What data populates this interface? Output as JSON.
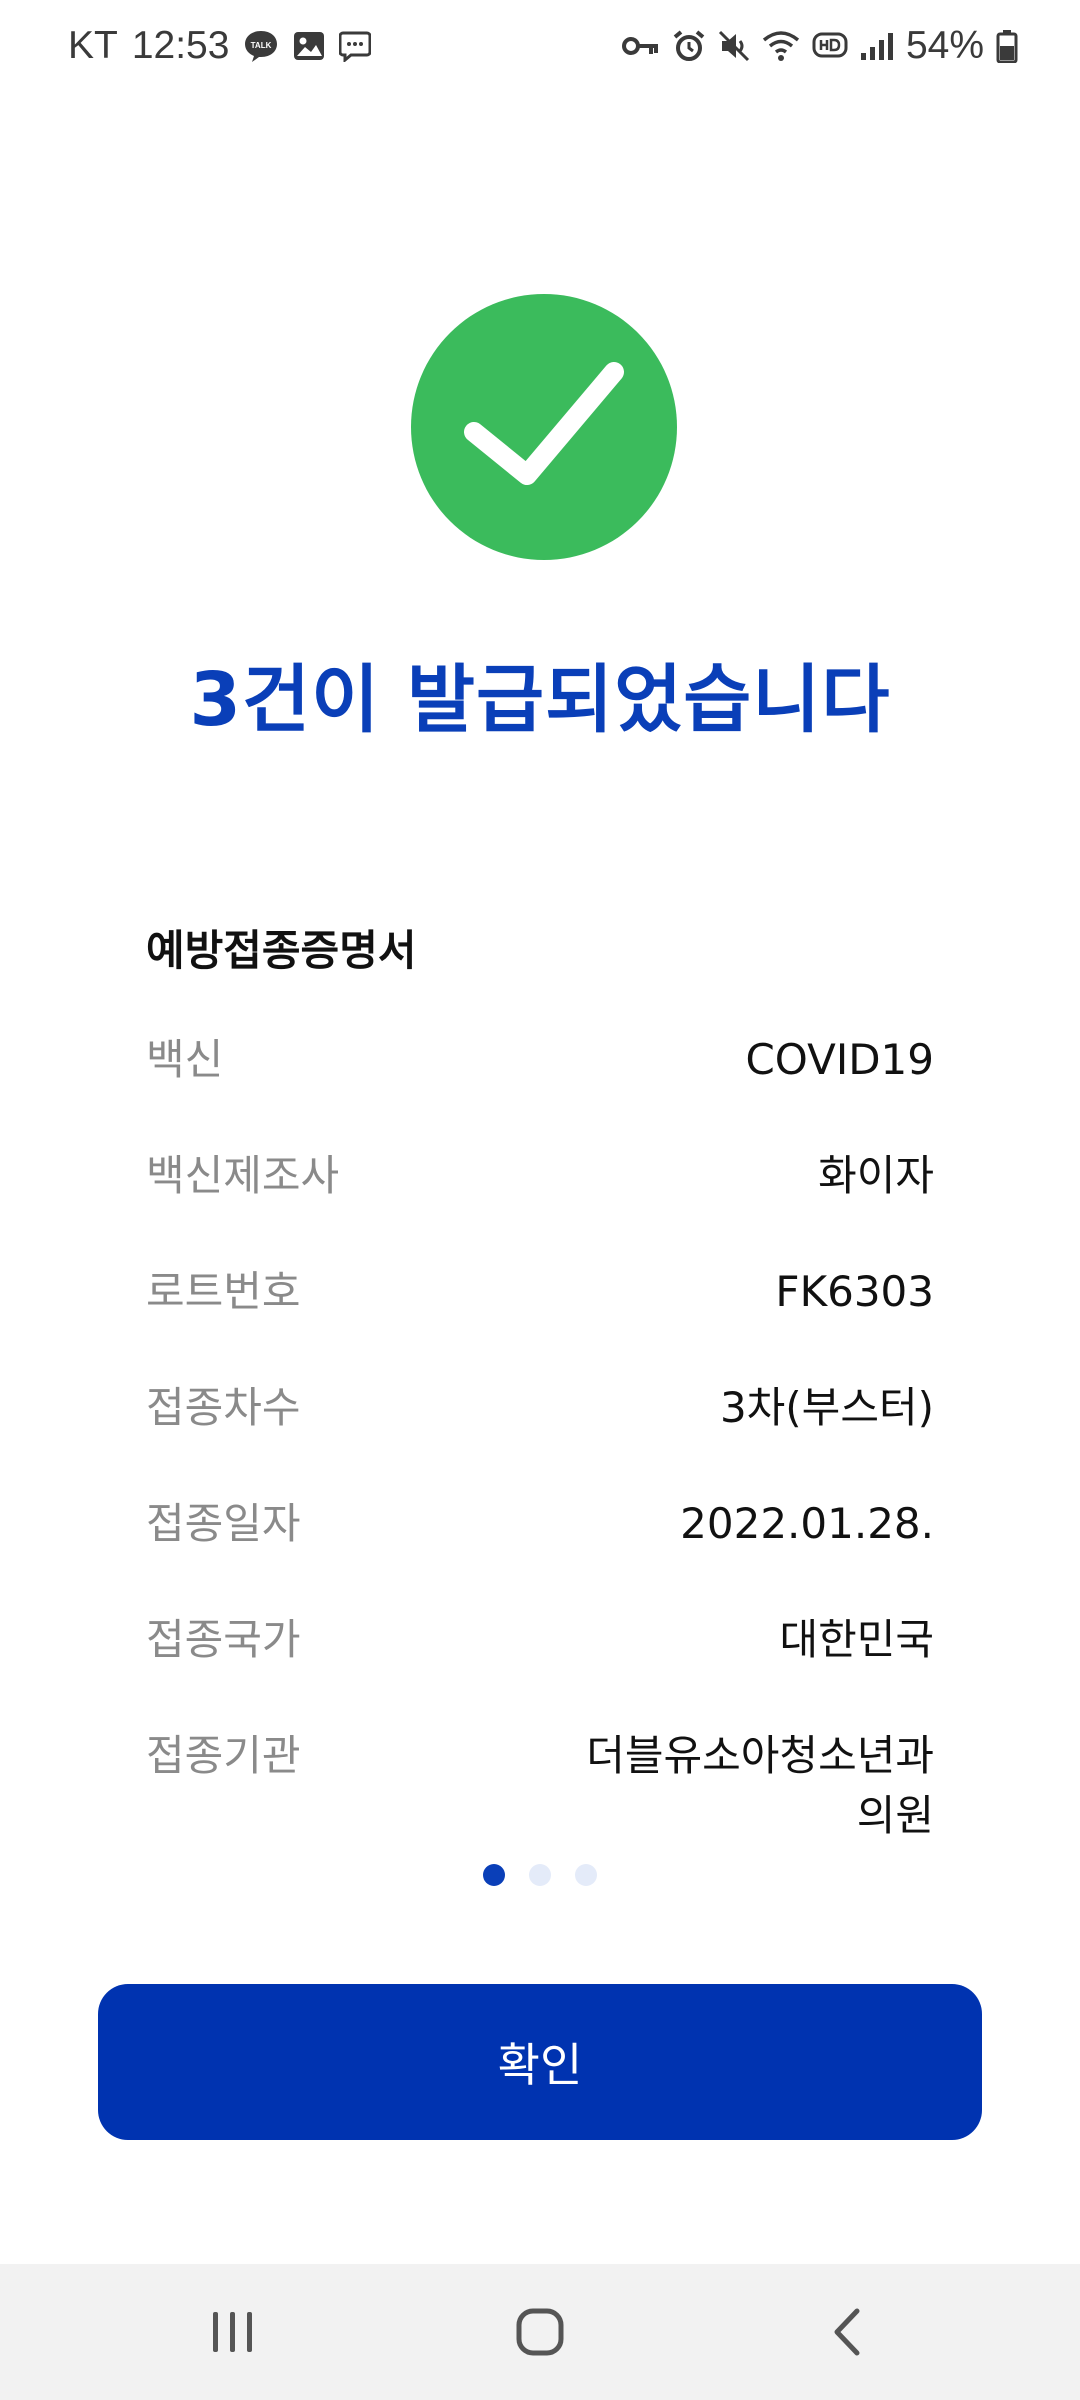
{
  "status_bar": {
    "carrier": "KT",
    "time": "12:53",
    "talk_badge": "TALK",
    "battery_percent": "54%"
  },
  "result": {
    "title": "3건이 발급되었습니다"
  },
  "certificate": {
    "title": "예방접종증명서",
    "rows": [
      {
        "label": "백신",
        "value": "COVID19"
      },
      {
        "label": "백신제조사",
        "value": "화이자"
      },
      {
        "label": "로트번호",
        "value": "FK6303"
      },
      {
        "label": "접종차수",
        "value": "3차(부스터)"
      },
      {
        "label": "접종일자",
        "value": "2022.01.28."
      },
      {
        "label": "접종국가",
        "value": "대한민국"
      },
      {
        "label": "접종기관",
        "value": "더블유소아청소년과\n의원"
      }
    ]
  },
  "pager": {
    "total": 3,
    "current": 1
  },
  "actions": {
    "confirm_label": "확인"
  },
  "colors": {
    "accent": "#0a3fb8",
    "button": "#0033b0",
    "success": "#3bbb5c",
    "label_gray": "#8a8a8a"
  },
  "icons": {
    "status_left": [
      "talk-icon",
      "image-icon",
      "message-icon"
    ],
    "status_right": [
      "key-icon",
      "alarm-icon",
      "mute-icon",
      "wifi-icon",
      "hd-icon",
      "signal-icon",
      "battery-icon"
    ],
    "nav": [
      "recent-apps-icon",
      "home-icon",
      "back-icon"
    ]
  }
}
